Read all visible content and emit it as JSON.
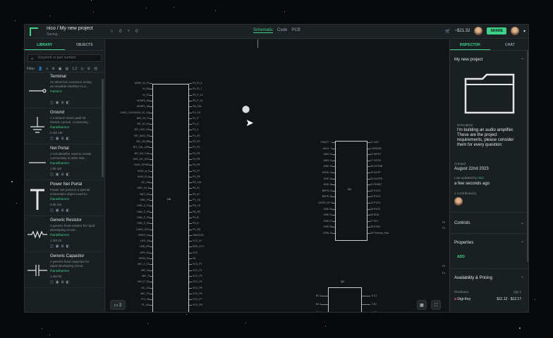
{
  "topbar": {
    "breadcrumb": "nico / My new project",
    "status": "Saving...",
    "star_count": "0",
    "fork_count": "0",
    "views": [
      "Schematic",
      "Code",
      "PCB"
    ],
    "active_view": "Schematic",
    "price": "~$21.32",
    "share_label": "SHARE"
  },
  "left": {
    "tabs": [
      "LIBRARY",
      "OBJECTS"
    ],
    "search_placeholder": "Keyword or part number",
    "filter_label": "Filter",
    "components": [
      {
        "name": "Terminal",
        "desc": "An electrical connector acting as reusable interface to a...",
        "author": "/nelance",
        "meta": "",
        "icon": "terminal-icon"
      },
      {
        "name": "Ground",
        "desc": "A common return path for electric current. Commonly...",
        "author": "/haneilbarnes",
        "meta": "0.1M  1M",
        "icon": "ground-icon"
      },
      {
        "name": "Net Portal",
        "desc": "A net identifier used to create connectivity to other Net...",
        "author": "/haneilbarnes",
        "meta": "1.0k  1M",
        "icon": "net-portal-icon"
      },
      {
        "name": "Power Net Portal",
        "desc": "Power net portal is a special schematics object used to...",
        "author": "/haneilbarnes",
        "meta": "3.5k  1M",
        "icon": "power-net-portal-icon"
      },
      {
        "name": "Generic Resistor",
        "desc": "A generic fixed resistor for rapid developing circuit...",
        "author": "/haneilbarnes",
        "meta": "1.2M  42",
        "icon": "resistor-icon"
      },
      {
        "name": "Generic Capacitor",
        "desc": "A generic fixed capacitor for rapid developing circuit...",
        "author": "/haneilbarnes",
        "meta": "1.4M  82",
        "icon": "capacitor-icon"
      }
    ]
  },
  "canvas": {
    "chip_u4_label": "U4",
    "chip_u1_label": "U1",
    "chip_q1_label": "Q1",
    "u4_left_pins": [
      "ASNP_IN_P1",
      "IO_N2",
      "IO_P3",
      "ADNP0_A5",
      "ADNP1_A6",
      "AVDD_LDO/AVDD_IO_I18",
      "BAT_IN_T1",
      "BIT_IO_N1",
      "BIT_LDO_VD",
      "BIT_AXIS_P0",
      "BIT_LB_RB",
      "BIT_CAL_LDR",
      "BIT_AG_CAL",
      "ADC_DC_DC1",
      "GUIO_GPIOD",
      "UNIO_A_F",
      "UNIO_B_A",
      "NC_H8",
      "UBIT_IN_E",
      "BNT_G2",
      "GND_F0",
      "GND_Z_F3",
      "GND_Z_F0",
      "GND_Z_F5",
      "GND_Z_F6",
      "LNSO_OUT",
      "GRIST_IN",
      "LDIT_IN",
      "USB_DP",
      "NPR_K4",
      "MOSI_E1",
      "MIC_1_C1",
      "MIC_IN",
      "MIC_P",
      "MIC_P_E1",
      "NC_G2",
      "MIC_P1",
      "PL1_IN",
      "PL_AU"
    ],
    "u4_right_pins": [
      "P4_PI_6",
      "P4_PI_7",
      "P5_P_12",
      "P5_P_A1",
      "P6_CAL",
      "P1_CS",
      "P1_P",
      "P1_D",
      "P1_3",
      "P1_E0",
      "P2_P0",
      "P2_P1",
      "P4_P4",
      "P4_P5",
      "P4_P6",
      "P4_P7",
      "P4_P8",
      "P5_CAL",
      "P5_IO",
      "P5_ID",
      "P7_CS",
      "P8_CS",
      "P8_SD",
      "P9_B",
      "P9_D",
      "P9_SD",
      "GNDCON",
      "VCC_IO",
      "ESD_VCC",
      "VCC",
      "NC",
      "VCC_P1",
      "VCC_P2",
      "VCC_P3",
      "VCC_P4",
      "VCC_P5",
      "VCC_P6",
      "VCC_P7",
      "VCC_P8"
    ],
    "u1_left_pins": [
      "~FAULT~ 1",
      "~MUX~ 2",
      "AIN2 11",
      "AIN1 11",
      "AIN2 13",
      "AVDD 14",
      "BSP 16",
      "BSN 18",
      "BSPN 20",
      "BSPR 18",
      "GVDD_NY 8",
      "GND 26",
      "GND 21",
      "GND 27",
      "GND 28",
      "LRIN 10"
    ],
    "u1_right_pins": [
      "11 LINT",
      "1 MODSD",
      "10 INPUT",
      "17 OUTN",
      "18 OUTNB",
      "19 OUTP",
      "20 OUTPR",
      "21 PLIMIT",
      "22 PVCC",
      "23 PVCC",
      "24 PVCC",
      "25 PVCC",
      "26 SDA",
      "27 SCL",
      "28 SYNC",
      "29 Thermal_Pad"
    ],
    "q1_left_pins": [
      "B2 4",
      "B3 3",
      "C1 6"
    ],
    "q1_right_pins": [
      "6 C2",
      "2 B1",
      "1 E1"
    ],
    "side_labels": [
      "P2",
      "P1",
      "P2",
      "P1"
    ],
    "comment_count": "2"
  },
  "inspector": {
    "tabs": [
      "INSPECTOR",
      "CHAT"
    ],
    "project_title": "My new project",
    "description_label": "Description",
    "description": "I'm building an audio amplifier. These are the project requirements, please consider them for every question:",
    "created_label": "Created",
    "created_value": "August 22nd 2023",
    "updated_label": "Last updated by",
    "updated_by": "nico",
    "updated_value": "a few seconds ago",
    "contributors_label": "1 Contributor(s)",
    "sections": [
      "Controls",
      "Properties"
    ],
    "add_label": "ADD",
    "availability_title": "Availability & Pricing",
    "distributor_label": "Distributor",
    "qty_label": "Qty 1",
    "distributor_name": "Digi-Key",
    "price_range": "$11.12 - $12.17"
  },
  "colors": {
    "accent": "#3fd18a",
    "panel": "#1a1f21",
    "canvas": "#111416"
  }
}
